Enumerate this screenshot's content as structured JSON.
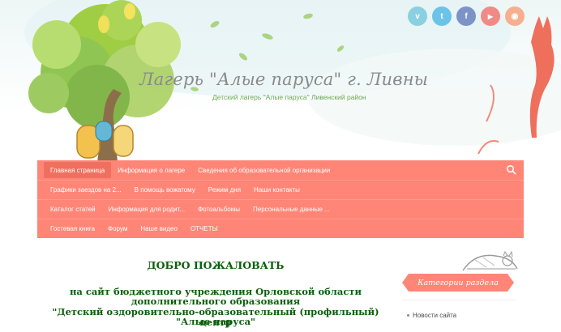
{
  "header": {
    "title": "Лагерь \"Алые паруса\" г. Ливны",
    "subtitle": "Детский лагерь \"Алые паруса\" Ливенский район"
  },
  "social": [
    {
      "name": "vimeo-icon",
      "glyph": "v",
      "color": "#8ad0e0"
    },
    {
      "name": "twitter-icon",
      "glyph": "t",
      "color": "#6cc3e8"
    },
    {
      "name": "facebook-icon",
      "glyph": "f",
      "color": "#7b93c6"
    },
    {
      "name": "youtube-icon",
      "glyph": "▶",
      "color": "#f08a86"
    },
    {
      "name": "rss-icon",
      "glyph": "◉",
      "color": "#f6b08f"
    }
  ],
  "nav": {
    "row1": [
      {
        "label": "Главная страница",
        "active": true
      },
      {
        "label": "Информация о лагере"
      },
      {
        "label": "Сведения об образовательной организации"
      }
    ],
    "row2": [
      {
        "label": "Графики заездов на 2..."
      },
      {
        "label": "В помощь вожатому"
      },
      {
        "label": "Режим дня"
      },
      {
        "label": "Наши контакты"
      }
    ],
    "row3": [
      {
        "label": "Каталог статей"
      },
      {
        "label": "Информация для родит..."
      },
      {
        "label": "Фотоальбомы"
      },
      {
        "label": "Персональные данные ..."
      }
    ],
    "row4": [
      {
        "label": "Гостевая книга"
      },
      {
        "label": "Форум"
      },
      {
        "label": "Наше видео"
      },
      {
        "label": "ОТЧЕТЫ"
      }
    ]
  },
  "content": {
    "welcome": "ДОБРО ПОЖАЛОВАТЬ",
    "lines": [
      "на сайт бюджетного учреждения Орловской области",
      "дополнительного образования",
      "\"Детский оздоровительно-образовательный (профильный) центр",
      "\"Алые паруса\""
    ]
  },
  "sidebar": {
    "category_title": "Категории раздела",
    "items": [
      "Новости сайта"
    ]
  },
  "colors": {
    "accent": "#ff8576",
    "welcome_text": "#0b5e0b",
    "subtitle": "#6aa84f"
  }
}
